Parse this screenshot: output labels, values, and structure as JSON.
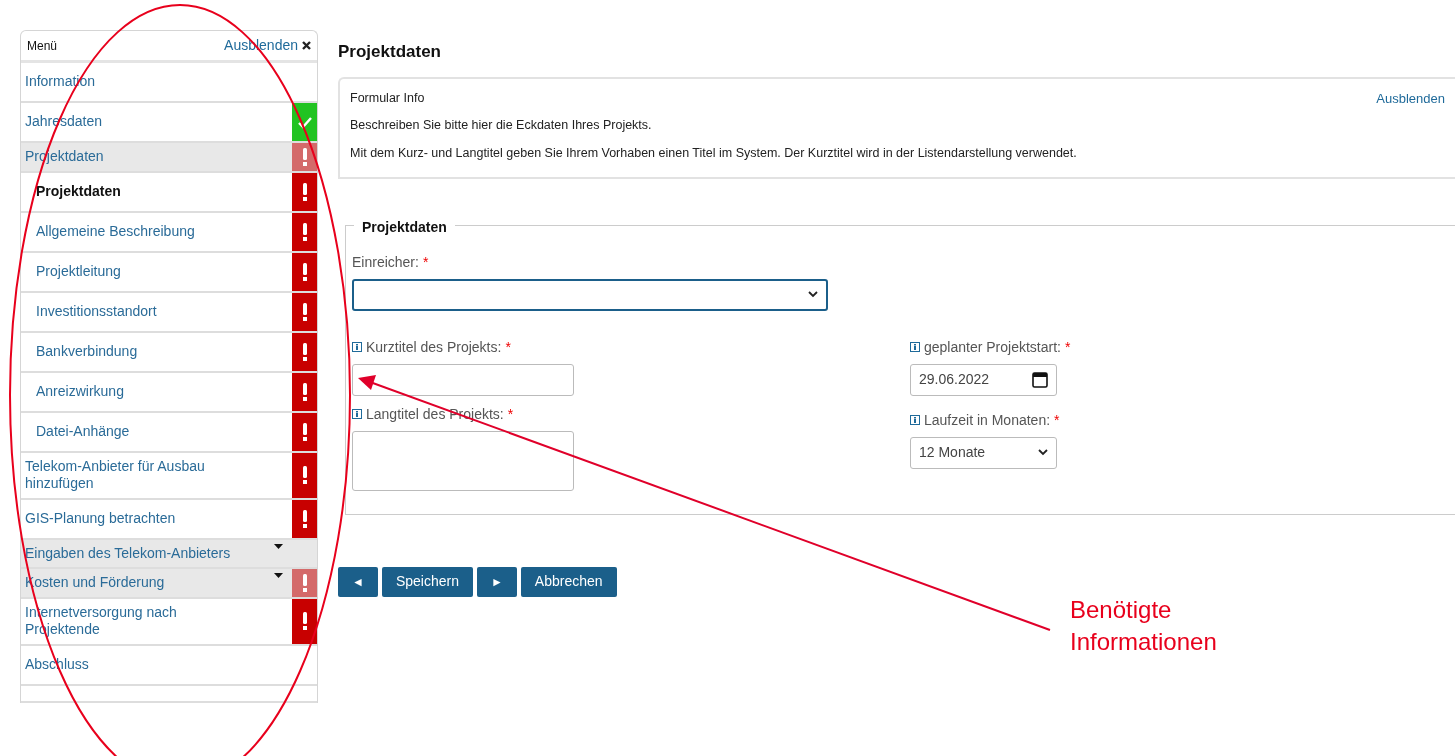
{
  "sidebar": {
    "title": "Menü",
    "hide_link": "Ausblenden",
    "items": [
      {
        "kind": "link",
        "label": "Information",
        "selected": false,
        "complete": false,
        "incomplete": false
      },
      {
        "kind": "link",
        "label": "Jahresdaten",
        "complete": true,
        "incomplete": false,
        "selected": false
      },
      {
        "kind": "group",
        "label": "Projektdaten",
        "complete": false,
        "incomplete": true,
        "expanded": true,
        "selected": false,
        "children": [
          {
            "label": "Projektdaten",
            "complete": false,
            "incomplete": true,
            "selected": true
          },
          {
            "label": "Allgemeine Beschreibung",
            "complete": false,
            "incomplete": true,
            "selected": false
          },
          {
            "label": "Projektleitung",
            "complete": false,
            "incomplete": true,
            "selected": false
          },
          {
            "label": "Investitionsstandort",
            "complete": false,
            "incomplete": true,
            "selected": false
          },
          {
            "label": "Bankverbindung",
            "complete": false,
            "incomplete": true,
            "selected": false
          },
          {
            "label": "Anreizwirkung",
            "complete": false,
            "incomplete": true,
            "selected": false
          },
          {
            "label": "Datei-Anhänge",
            "complete": false,
            "incomplete": true,
            "selected": false
          }
        ]
      },
      {
        "kind": "link",
        "label": "Telekom-Anbieter für Ausbau hinzufügen",
        "complete": false,
        "incomplete": true,
        "selected": false
      },
      {
        "kind": "link",
        "label": "GIS-Planung betrachten",
        "complete": false,
        "incomplete": true,
        "selected": false
      },
      {
        "kind": "group",
        "label": "Eingaben des Telekom-Anbieters",
        "complete": false,
        "incomplete": false,
        "expanded": false,
        "selected": false
      },
      {
        "kind": "group",
        "label": "Kosten und Förderung",
        "complete": false,
        "incomplete": true,
        "expanded": false,
        "selected": false
      },
      {
        "kind": "link",
        "label": "Internetversorgung nach Projektende",
        "complete": false,
        "incomplete": true,
        "selected": false
      },
      {
        "kind": "link",
        "label": "Abschluss",
        "complete": false,
        "incomplete": false,
        "selected": false
      }
    ]
  },
  "page_title": "Projektdaten",
  "info_box": {
    "title": "Formular Info",
    "hide_link": "Ausblenden",
    "lines": [
      "Beschreiben Sie bitte hier die Eckdaten Ihres Projekts.",
      "Mit dem Kurz- und Langtitel geben Sie Ihrem Vorhaben einen Titel im System. Der Kurztitel wird in der Listendarstellung verwendet."
    ]
  },
  "fieldset": {
    "legend": "Projektdaten",
    "submitter": {
      "label": "Einreicher:",
      "required_mark": "*",
      "focused": true
    },
    "left_fields": [
      {
        "label": "Kurztitel des Projekts:",
        "required_mark": "*",
        "kind": "text"
      },
      {
        "label": "Langtitel des Projekts:",
        "required_mark": "*",
        "kind": "textarea"
      }
    ],
    "right_fields": [
      {
        "label": "geplanter Projektstart:",
        "required_mark": "*",
        "kind": "date",
        "value": "29.06.2022"
      },
      {
        "label": "Laufzeit in Monaten:",
        "required_mark": "*",
        "kind": "select",
        "value": "12 Monate"
      }
    ]
  },
  "buttons": [
    {
      "kind": "prev",
      "label": "◄"
    },
    {
      "kind": "text",
      "label": "Speichern"
    },
    {
      "kind": "next",
      "label": "►"
    },
    {
      "kind": "text",
      "label": "Abbrechen"
    }
  ],
  "annotation": {
    "text": "Benötigte Informationen"
  }
}
